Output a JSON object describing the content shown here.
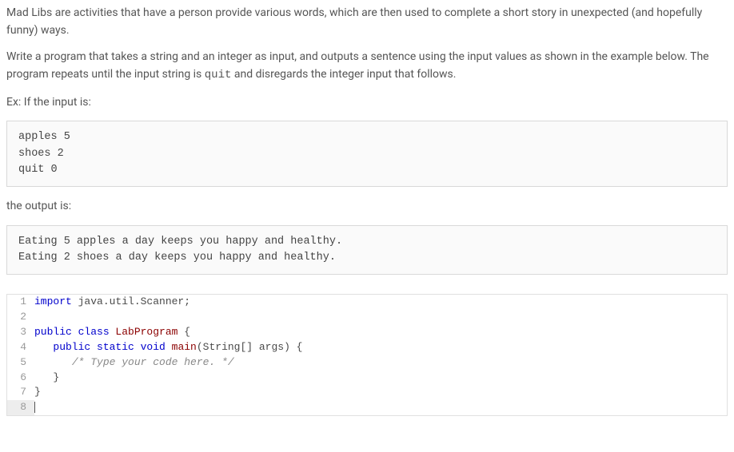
{
  "intro": {
    "p1": "Mad Libs are activities that have a person provide various words, which are then used to complete a short story in unexpected (and hopefully funny) ways.",
    "p2a": "Write a program that takes a string and an integer as input, and outputs a sentence using the input values as shown in the example below. The program repeats until the input string is ",
    "p2_code": "quit",
    "p2b": " and disregards the integer input that follows.",
    "p3": "Ex: If the input is:"
  },
  "input_block": "apples 5\nshoes 2\nquit 0",
  "mid": "the output is:",
  "output_block": "Eating 5 apples a day keeps you happy and healthy.\nEating 2 shoes a day keeps you happy and healthy.",
  "code": {
    "lines": [
      {
        "n": "1",
        "segs": [
          {
            "t": "import",
            "c": "kw"
          },
          {
            "t": " java.util.Scanner;",
            "c": ""
          }
        ]
      },
      {
        "n": "2",
        "segs": []
      },
      {
        "n": "3",
        "segs": [
          {
            "t": "public class ",
            "c": "kw"
          },
          {
            "t": "LabProgram",
            "c": "cls"
          },
          {
            "t": " {",
            "c": ""
          }
        ]
      },
      {
        "n": "4",
        "segs": [
          {
            "t": "   ",
            "c": ""
          },
          {
            "t": "public static void ",
            "c": "kw"
          },
          {
            "t": "main",
            "c": "fn"
          },
          {
            "t": "(String[] args) {",
            "c": ""
          }
        ]
      },
      {
        "n": "5",
        "segs": [
          {
            "t": "      ",
            "c": ""
          },
          {
            "t": "/* Type your code here. */",
            "c": "cmt"
          }
        ]
      },
      {
        "n": "6",
        "segs": [
          {
            "t": "   }",
            "c": ""
          }
        ]
      },
      {
        "n": "7",
        "segs": [
          {
            "t": "}",
            "c": ""
          }
        ]
      },
      {
        "n": "8",
        "segs": [],
        "current": true
      }
    ]
  }
}
